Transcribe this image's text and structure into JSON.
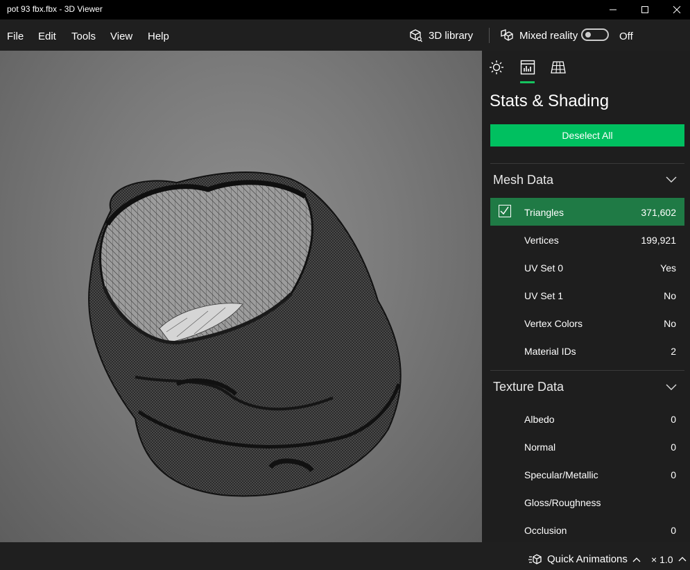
{
  "window": {
    "title": "pot 93 fbx.fbx - 3D Viewer",
    "controls": [
      "minimize-icon",
      "maximize-icon",
      "close-icon"
    ]
  },
  "menu": {
    "items": [
      "File",
      "Edit",
      "Tools",
      "View",
      "Help"
    ],
    "library_label": "3D library",
    "mixed_reality_label": "Mixed reality",
    "toggle_state": "Off"
  },
  "panel": {
    "tabs": [
      "sun-icon",
      "stats-icon",
      "grid-icon"
    ],
    "active_tab": 1,
    "title": "Stats & Shading",
    "deselect_label": "Deselect All",
    "mesh": {
      "heading": "Mesh Data",
      "rows": [
        {
          "label": "Triangles",
          "value": "371,602",
          "selected": true
        },
        {
          "label": "Vertices",
          "value": "199,921"
        },
        {
          "label": "UV Set 0",
          "value": "Yes"
        },
        {
          "label": "UV Set 1",
          "value": "No"
        },
        {
          "label": "Vertex Colors",
          "value": "No"
        },
        {
          "label": "Material IDs",
          "value": "2"
        }
      ]
    },
    "texture": {
      "heading": "Texture Data",
      "rows": [
        {
          "label": "Albedo",
          "value": "0"
        },
        {
          "label": "Normal",
          "value": "0"
        },
        {
          "label": "Specular/Metallic",
          "value": "0"
        },
        {
          "label": "Gloss/Roughness",
          "value": ""
        },
        {
          "label": "Occlusion",
          "value": "0"
        }
      ]
    }
  },
  "status": {
    "quick_animations": "Quick Animations",
    "speed": "× 1.0"
  },
  "colors": {
    "accent": "#00c060",
    "selected_row": "#1f7a45",
    "panel_bg": "#1e1e1e"
  }
}
